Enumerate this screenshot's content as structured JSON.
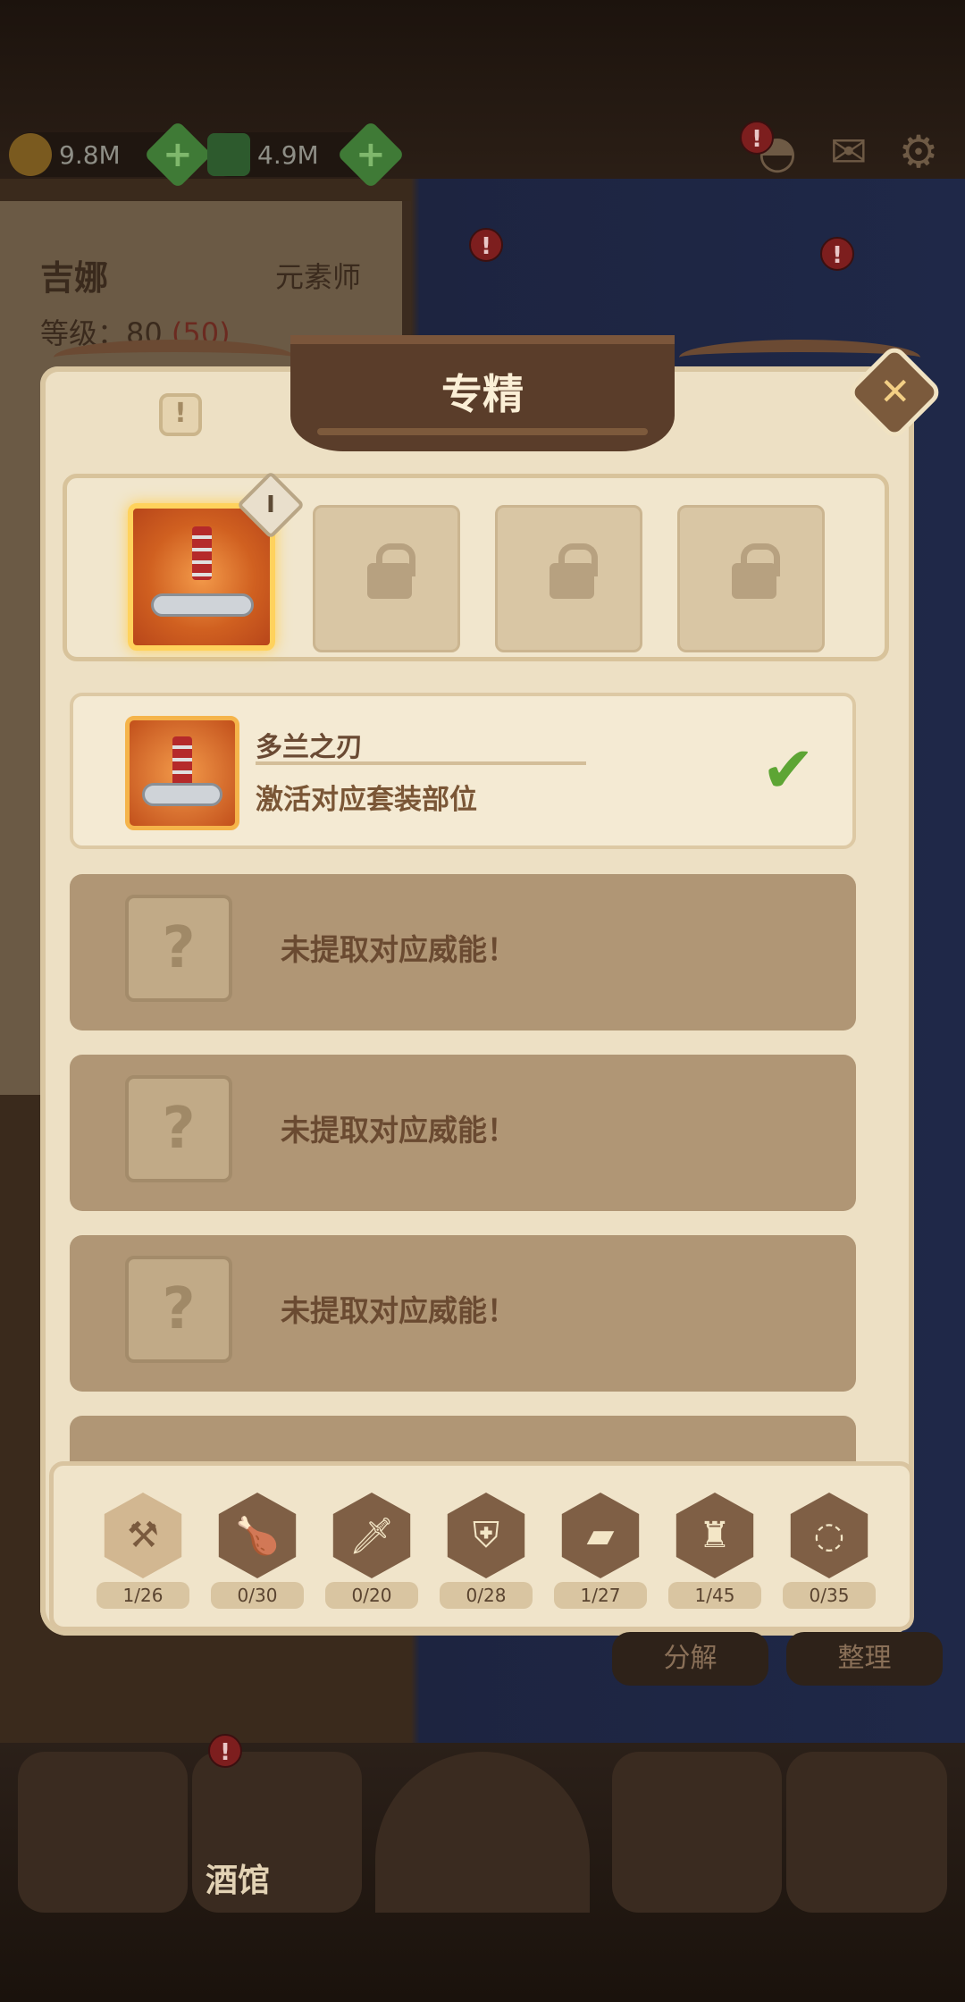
{
  "top_bar": {
    "gold": "9.8M",
    "gems": "4.9M",
    "badge_mark": "!"
  },
  "hero": {
    "name": "吉娜",
    "class": "元素师",
    "level_label": "等级：80",
    "level_bonus": "(50)"
  },
  "modal": {
    "title": "专精",
    "info_mark": "!",
    "close_mark": "✕",
    "slot_marker": "Ⅰ"
  },
  "items": [
    {
      "name": "多兰之刃",
      "desc": "激活对应套装部位",
      "status": "activated"
    },
    {
      "text": "未提取对应威能！",
      "placeholder": "?"
    },
    {
      "text": "未提取对应威能！",
      "placeholder": "?"
    },
    {
      "text": "未提取对应威能！",
      "placeholder": "?"
    }
  ],
  "categories": [
    {
      "icon": "weapon-icon",
      "count": "1/26",
      "selected": true
    },
    {
      "icon": "meat-icon",
      "count": "0/30",
      "selected": false
    },
    {
      "icon": "sword-icon",
      "count": "0/20",
      "selected": false
    },
    {
      "icon": "shield-icon",
      "count": "0/28",
      "selected": false
    },
    {
      "icon": "book-icon",
      "count": "1/27",
      "selected": false
    },
    {
      "icon": "armor-icon",
      "count": "1/45",
      "selected": false
    },
    {
      "icon": "necklace-icon",
      "count": "0/35",
      "selected": false
    }
  ],
  "background_buttons": {
    "decompose": "分解",
    "sort": "整理"
  },
  "nav": {
    "tavern": "酒馆"
  }
}
